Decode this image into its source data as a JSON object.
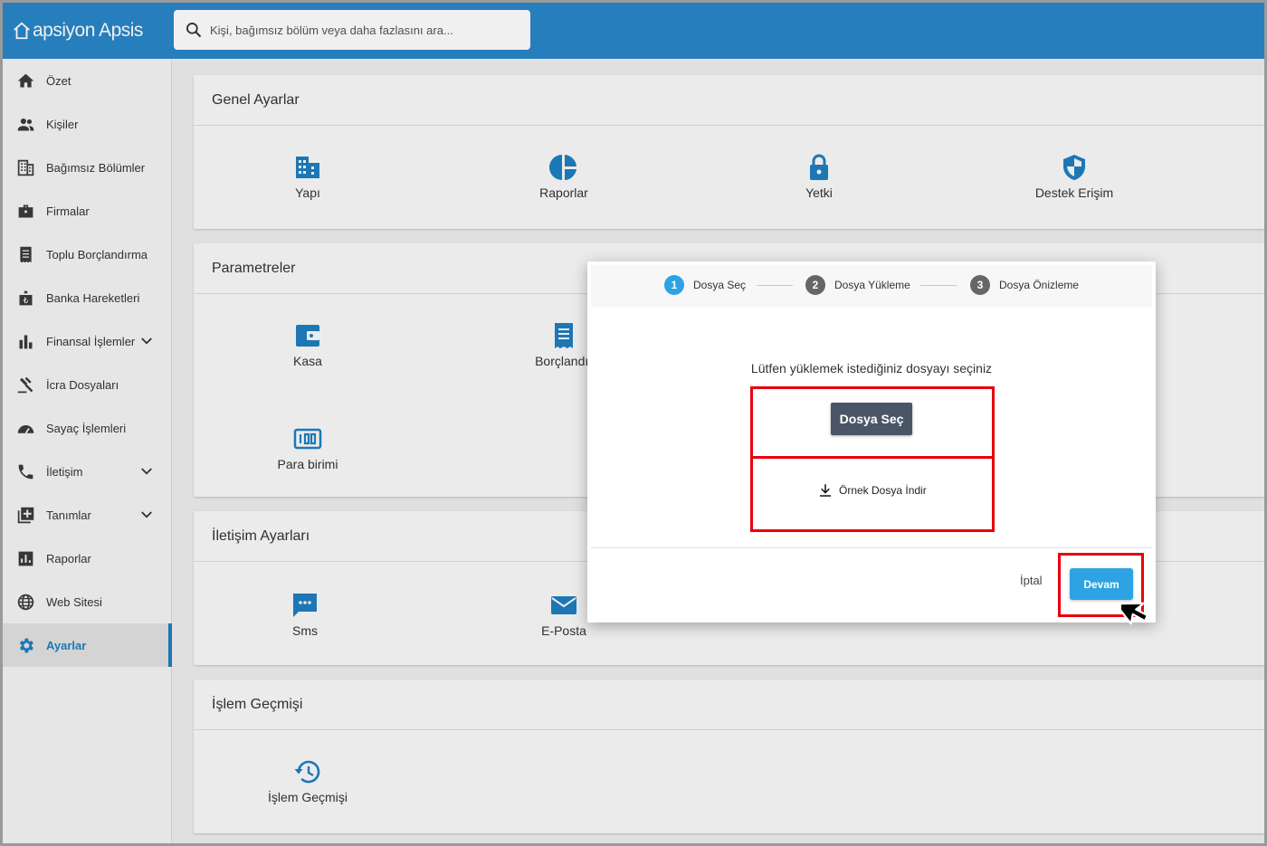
{
  "app": {
    "brand": "apsiyon Apsis"
  },
  "search": {
    "placeholder": "Kişi, bağımsız bölüm veya daha fazlasını ara..."
  },
  "sidebar": {
    "items": [
      {
        "label": "Özet",
        "icon": "home-icon"
      },
      {
        "label": "Kişiler",
        "icon": "people-icon"
      },
      {
        "label": "Bağımsız Bölümler",
        "icon": "building-icon"
      },
      {
        "label": "Firmalar",
        "icon": "briefcase-icon"
      },
      {
        "label": "Toplu Borçlandırma",
        "icon": "receipt-icon"
      },
      {
        "label": "Banka Hareketleri",
        "icon": "bank-icon"
      },
      {
        "label": "Finansal İşlemler",
        "icon": "bar-chart-icon",
        "expandable": true
      },
      {
        "label": "İcra Dosyaları",
        "icon": "gavel-icon"
      },
      {
        "label": "Sayaç İşlemleri",
        "icon": "meter-icon"
      },
      {
        "label": "İletişim",
        "icon": "phone-icon",
        "expandable": true
      },
      {
        "label": "Tanımlar",
        "icon": "library-add-icon",
        "expandable": true
      },
      {
        "label": "Raporlar",
        "icon": "report-icon"
      },
      {
        "label": "Web Sitesi",
        "icon": "globe-icon"
      },
      {
        "label": "Ayarlar",
        "icon": "gear-icon",
        "active": true
      }
    ]
  },
  "sections": {
    "genel": {
      "title": "Genel Ayarlar",
      "tiles": [
        "Yapı",
        "Raporlar",
        "Yetki",
        "Destek Erişim"
      ]
    },
    "parametreler": {
      "title": "Parametreler",
      "tiles": [
        "Kasa",
        "Borçlandır",
        "Para birimi"
      ]
    },
    "iletisim": {
      "title": "İletişim Ayarları",
      "tiles": [
        "Sms",
        "E-Posta"
      ]
    },
    "islem": {
      "title": "İşlem Geçmişi",
      "tiles": [
        "İşlem Geçmişi"
      ]
    }
  },
  "modal": {
    "steps": [
      {
        "num": "1",
        "label": "Dosya Seç",
        "active": true
      },
      {
        "num": "2",
        "label": "Dosya Yükleme"
      },
      {
        "num": "3",
        "label": "Dosya Önizleme"
      }
    ],
    "message": "Lütfen yüklemek istediğiniz dosyayı seçiniz",
    "select_button": "Dosya Seç",
    "download_label": "Örnek Dosya İndir",
    "cancel_label": "İptal",
    "continue_label": "Devam"
  },
  "colors": {
    "header": "#2a86c8",
    "accent": "#2ea3e3",
    "highlight": "#e8000b",
    "select_button": "#4a5666"
  }
}
